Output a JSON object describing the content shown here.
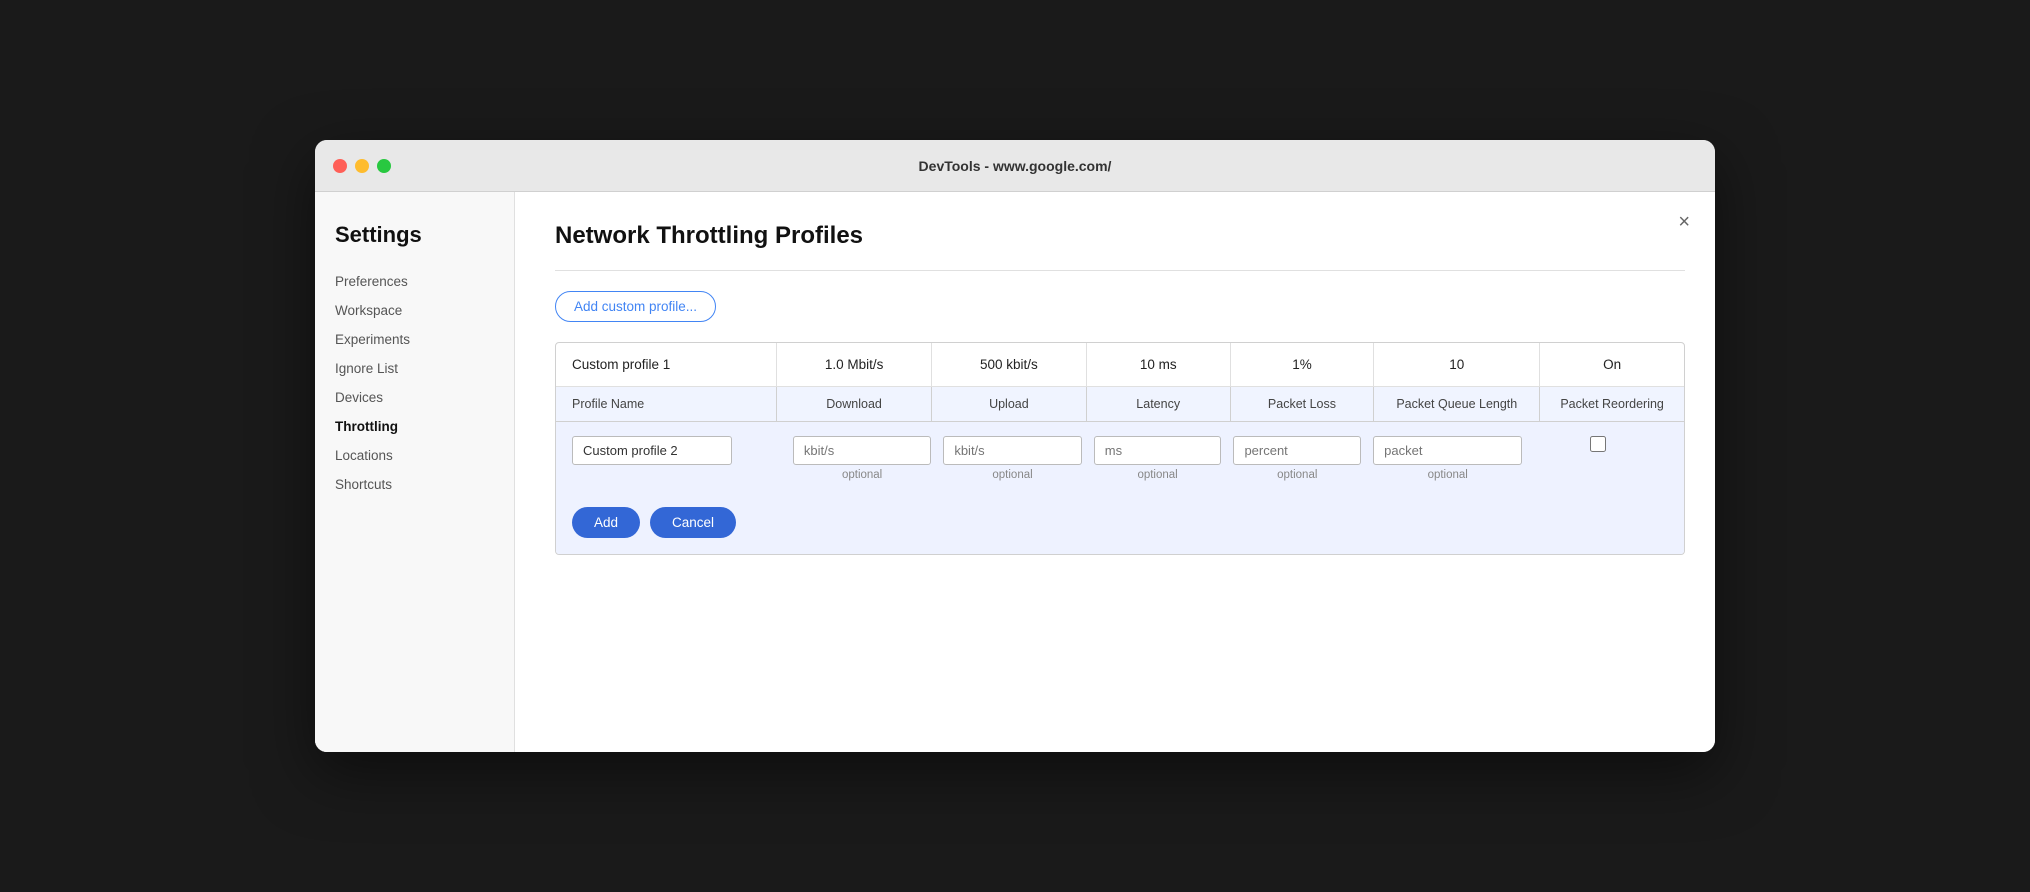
{
  "window": {
    "title": "DevTools - www.google.com/"
  },
  "sidebar": {
    "heading": "Settings",
    "items": [
      {
        "id": "preferences",
        "label": "Preferences",
        "active": false
      },
      {
        "id": "workspace",
        "label": "Workspace",
        "active": false
      },
      {
        "id": "experiments",
        "label": "Experiments",
        "active": false
      },
      {
        "id": "ignore-list",
        "label": "Ignore List",
        "active": false
      },
      {
        "id": "devices",
        "label": "Devices",
        "active": false
      },
      {
        "id": "throttling",
        "label": "Throttling",
        "active": true
      },
      {
        "id": "locations",
        "label": "Locations",
        "active": false
      },
      {
        "id": "shortcuts",
        "label": "Shortcuts",
        "active": false
      }
    ]
  },
  "main": {
    "title": "Network Throttling Profiles",
    "add_button_label": "Add custom profile...",
    "close_label": "×",
    "existing_profile": {
      "name": "Custom profile 1",
      "download": "1.0 Mbit/s",
      "upload": "500 kbit/s",
      "latency": "10 ms",
      "packet_loss": "1%",
      "packet_queue": "10",
      "packet_reorder": "On"
    },
    "table_headers": {
      "name": "Profile Name",
      "download": "Download",
      "upload": "Upload",
      "latency": "Latency",
      "packet_loss": "Packet Loss",
      "packet_queue": "Packet Queue Length",
      "packet_reorder": "Packet Reordering"
    },
    "new_profile": {
      "name_placeholder": "Custom profile 2",
      "name_value": "Custom profile 2",
      "download_placeholder": "kbit/s",
      "download_hint": "optional",
      "upload_placeholder": "kbit/s",
      "upload_hint": "optional",
      "latency_placeholder": "ms",
      "latency_hint": "optional",
      "packet_loss_placeholder": "percent",
      "packet_loss_hint": "optional",
      "packet_queue_placeholder": "packet",
      "packet_queue_hint": "optional"
    },
    "buttons": {
      "add": "Add",
      "cancel": "Cancel"
    }
  }
}
